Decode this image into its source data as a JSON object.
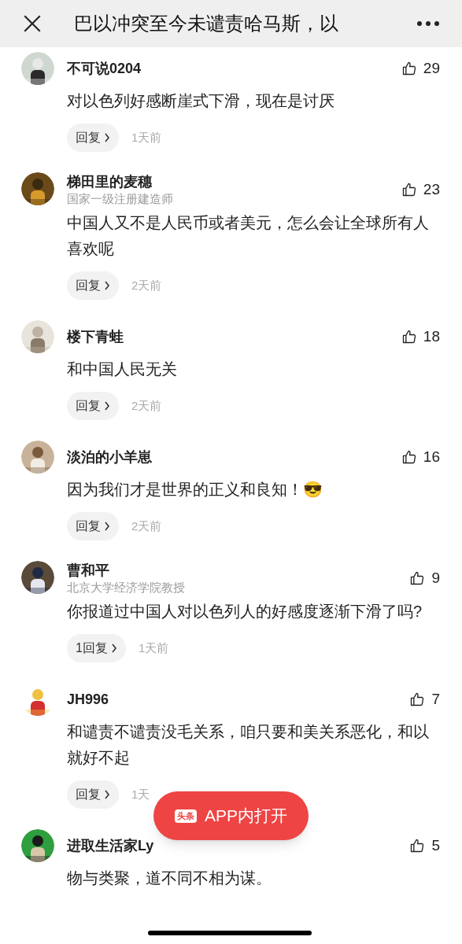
{
  "header": {
    "title": "巴以冲突至今未谴责哈马斯，以"
  },
  "comments": [
    {
      "name": "不可说0204",
      "likes": "29",
      "text": "对以色列好感断崖式下滑，现在是讨厌",
      "reply": "回复",
      "time": "1天前"
    },
    {
      "name": "梯田里的麦穗",
      "subtitle": "国家一级注册建造师",
      "likes": "23",
      "text": "中国人又不是人民币或者美元，怎么会让全球所有人喜欢呢",
      "reply": "回复",
      "time": "2天前"
    },
    {
      "name": "楼下青蛙",
      "likes": "18",
      "text": "和中国人民无关",
      "reply": "回复",
      "time": "2天前"
    },
    {
      "name": "淡泊的小羊崽",
      "likes": "16",
      "text": "因为我们才是世界的正义和良知！😎",
      "reply": "回复",
      "time": "2天前"
    },
    {
      "name": "曹和平",
      "subtitle": "北京大学经济学院教授",
      "likes": "9",
      "text": "你报道过中国人对以色列人的好感度逐渐下滑了吗?",
      "reply": "1回复",
      "time": "1天前"
    },
    {
      "name": "JH996",
      "likes": "7",
      "text": "和谴责不谴责没毛关系，咱只要和美关系恶化，和以就好不起",
      "reply": "回复",
      "time": "1天"
    },
    {
      "name": "进取生活家Ly",
      "likes": "5",
      "text": "物与类聚，道不同不相为谋。"
    }
  ],
  "open_app": {
    "logo_text": "头条",
    "label": "APP内打开"
  }
}
